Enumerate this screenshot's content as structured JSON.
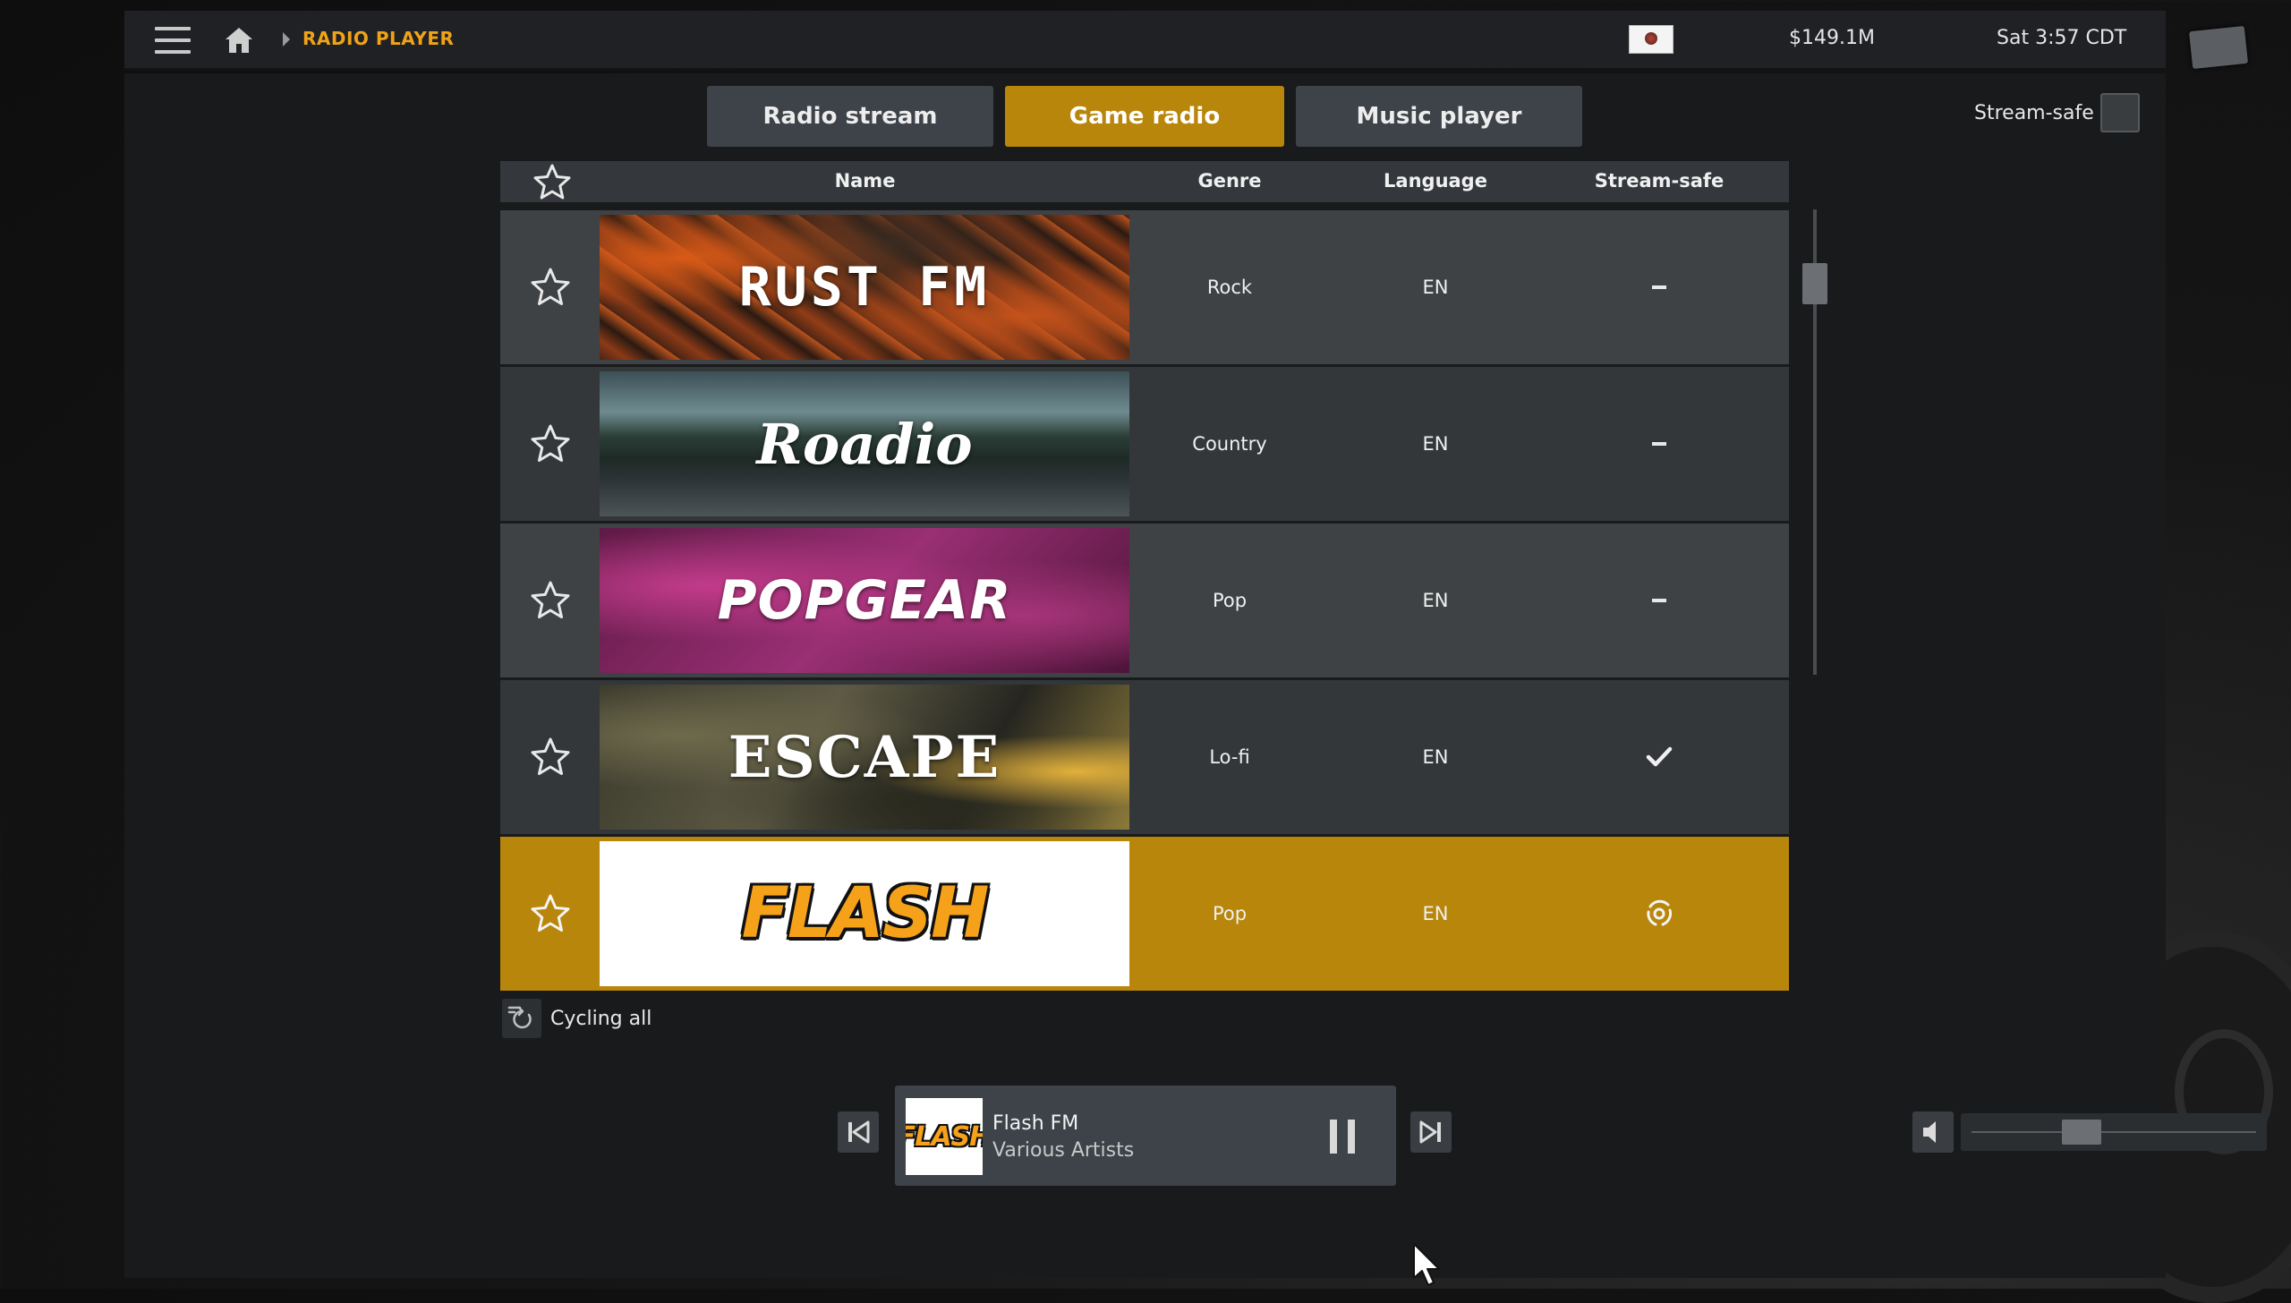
{
  "header": {
    "breadcrumb": "RADIO PLAYER",
    "money": "$149.1M",
    "clock": "Sat 3:57 CDT"
  },
  "tabs": [
    {
      "label": "Radio stream",
      "active": false
    },
    {
      "label": "Game radio",
      "active": true
    },
    {
      "label": "Music player",
      "active": false
    }
  ],
  "stream_safe_toggle": {
    "label": "Stream-safe",
    "checked": false
  },
  "table": {
    "columns": {
      "name": "Name",
      "genre": "Genre",
      "language": "Language",
      "stream_safe": "Stream-safe"
    },
    "rows": [
      {
        "logo_text": "RUST FM",
        "genre": "Rock",
        "language": "EN",
        "stream_safe": "dash"
      },
      {
        "logo_text": "Roadio",
        "genre": "Country",
        "language": "EN",
        "stream_safe": "dash"
      },
      {
        "logo_text": "POPGEAR",
        "genre": "Pop",
        "language": "EN",
        "stream_safe": "dash"
      },
      {
        "logo_text": "ESCAPE",
        "genre": "Lo-fi",
        "language": "EN",
        "stream_safe": "check"
      },
      {
        "logo_text": "FLASH",
        "genre": "Pop",
        "language": "EN",
        "stream_safe": "broadcast-icon",
        "selected": true
      }
    ]
  },
  "cycle": {
    "label": "Cycling all"
  },
  "player": {
    "logo_text": "FLASH",
    "title": "Flash FM",
    "artist": "Various Artists"
  },
  "volume": {
    "level": 0.29
  },
  "colors": {
    "accent": "#b8860b",
    "breadcrumb": "#f0a317",
    "tab_inactive": "#3d4349"
  }
}
